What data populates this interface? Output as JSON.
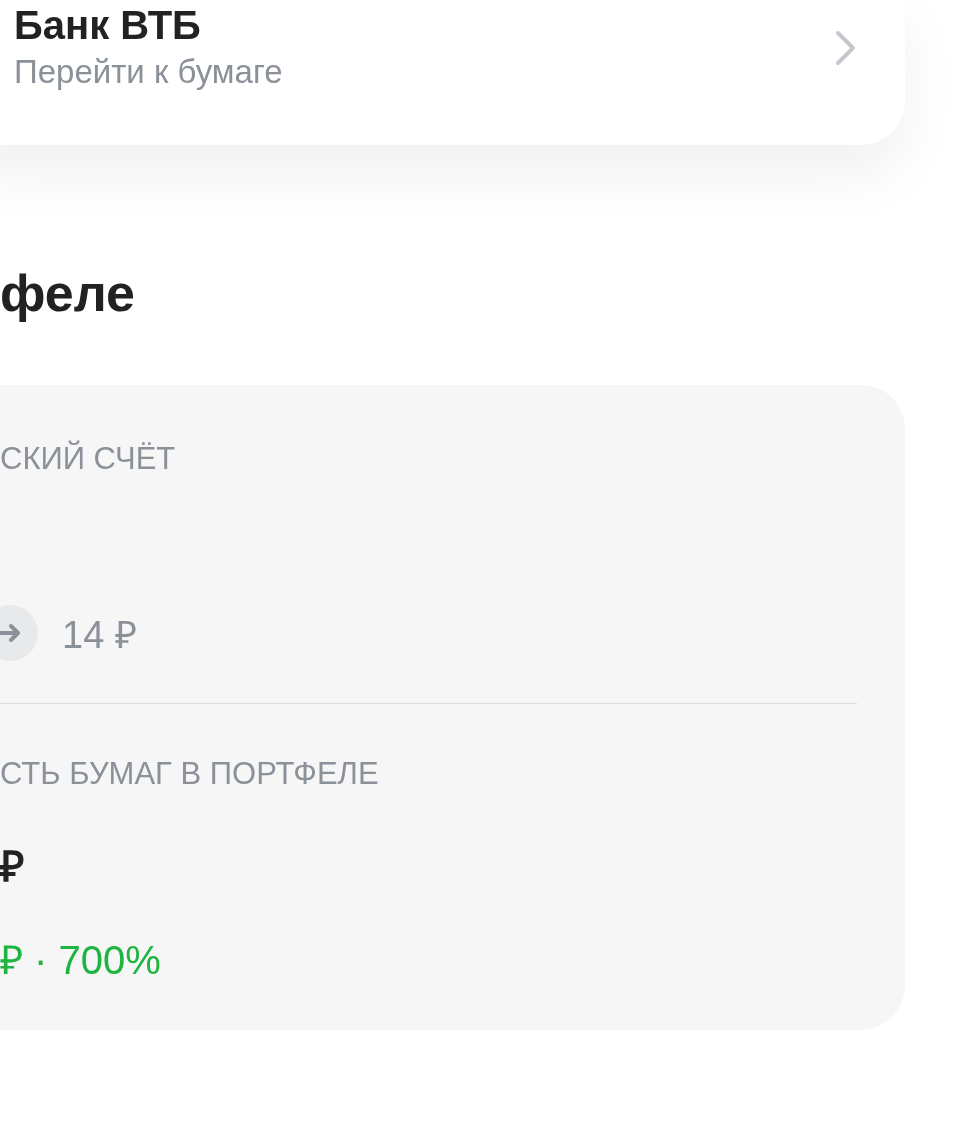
{
  "security_card": {
    "title": "Банк ВТБ",
    "link": "Перейти к бумаге"
  },
  "section_title": "феле",
  "portfolio_card": {
    "account_label": "СКИЙ СЧЁТ",
    "account_amount": "14 ₽",
    "value_label": "СТЬ БУМАГ В ПОРТФЕЛЕ",
    "value_amount": "₽",
    "change": "₽ · 700%"
  }
}
